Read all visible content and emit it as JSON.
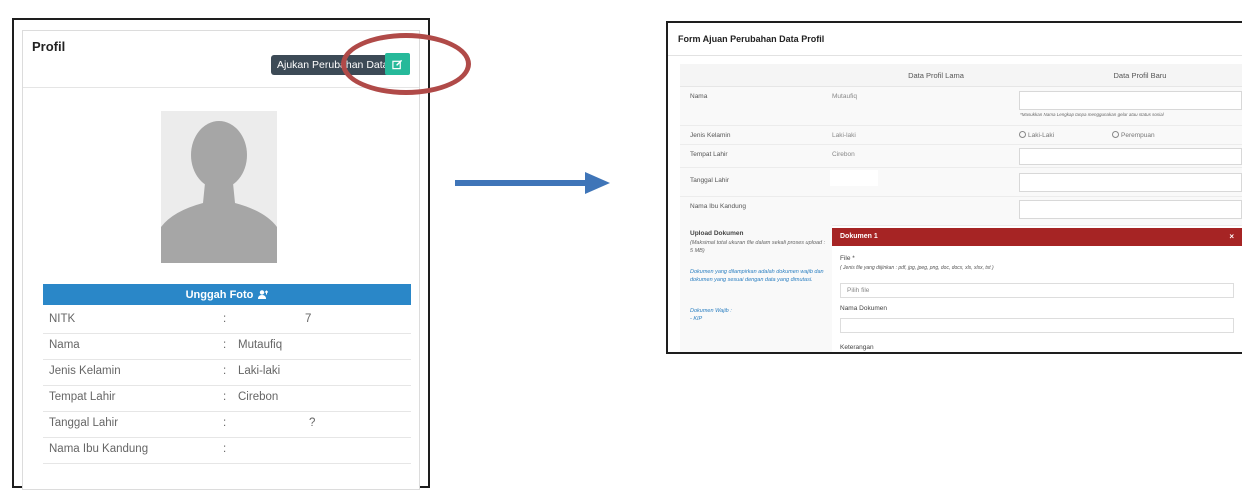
{
  "profile": {
    "title": "Profil",
    "tooltip": "Ajukan Perubahan Data",
    "upload_label": "Unggah Foto",
    "rows": [
      {
        "label": "NITK",
        "value": "7"
      },
      {
        "label": "Nama",
        "value": "Mutaufiq"
      },
      {
        "label": "Jenis Kelamin",
        "value": "Laki-laki"
      },
      {
        "label": "Tempat Lahir",
        "value": "Cirebon"
      },
      {
        "label": "Tanggal Lahir",
        "value": "?"
      },
      {
        "label": "Nama Ibu Kandung",
        "value": ""
      }
    ],
    "separator": ":"
  },
  "form": {
    "title": "Form Ajuan Perubahan Data Profil",
    "col_old": "Data Profil Lama",
    "col_new": "Data Profil Baru",
    "rows": {
      "nama": {
        "label": "Nama",
        "old": "Mutaufiq",
        "hint": "*Masukkan Nama Lengkap tanpa menggunakan gelar atau status sosial"
      },
      "jk": {
        "label": "Jenis Kelamin",
        "old": "Laki-laki",
        "opt1": "Laki-Laki",
        "opt2": "Perempuan"
      },
      "tempat": {
        "label": "Tempat Lahir",
        "old": "Cirebon"
      },
      "tanggal": {
        "label": "Tanggal Lahir"
      },
      "ibu": {
        "label": "Nama Ibu Kandung"
      }
    },
    "upload": {
      "title": "Upload Dokumen",
      "note": "(Maksimal total ukuran file dalam sekali proses upload : 5 MB)",
      "body": "Dokumen yang dilampirkan adalah dokumen wajib dan dokumen yang sesuai dengan data yang dimutasi.",
      "wajib_title": "Dokumen Wajib :",
      "wajib_item": "- KIP"
    },
    "doc": {
      "title": "Dokumen 1",
      "close": "×",
      "file_label": "File *",
      "file_types": "( Jenis file yang diijinkan : pdf, jpg, jpeg, png, doc, docx, xls, xlsx, txt )",
      "file_placeholder": "Pilih file",
      "name_label": "Nama Dokumen",
      "ket_label": "Keterangan"
    }
  },
  "colors": {
    "accent_green": "#26b99a",
    "accent_blue": "#2a87c8",
    "panel_red": "#a62424",
    "ring_red": "#b04a48",
    "arrow_blue": "#3f75b8"
  }
}
